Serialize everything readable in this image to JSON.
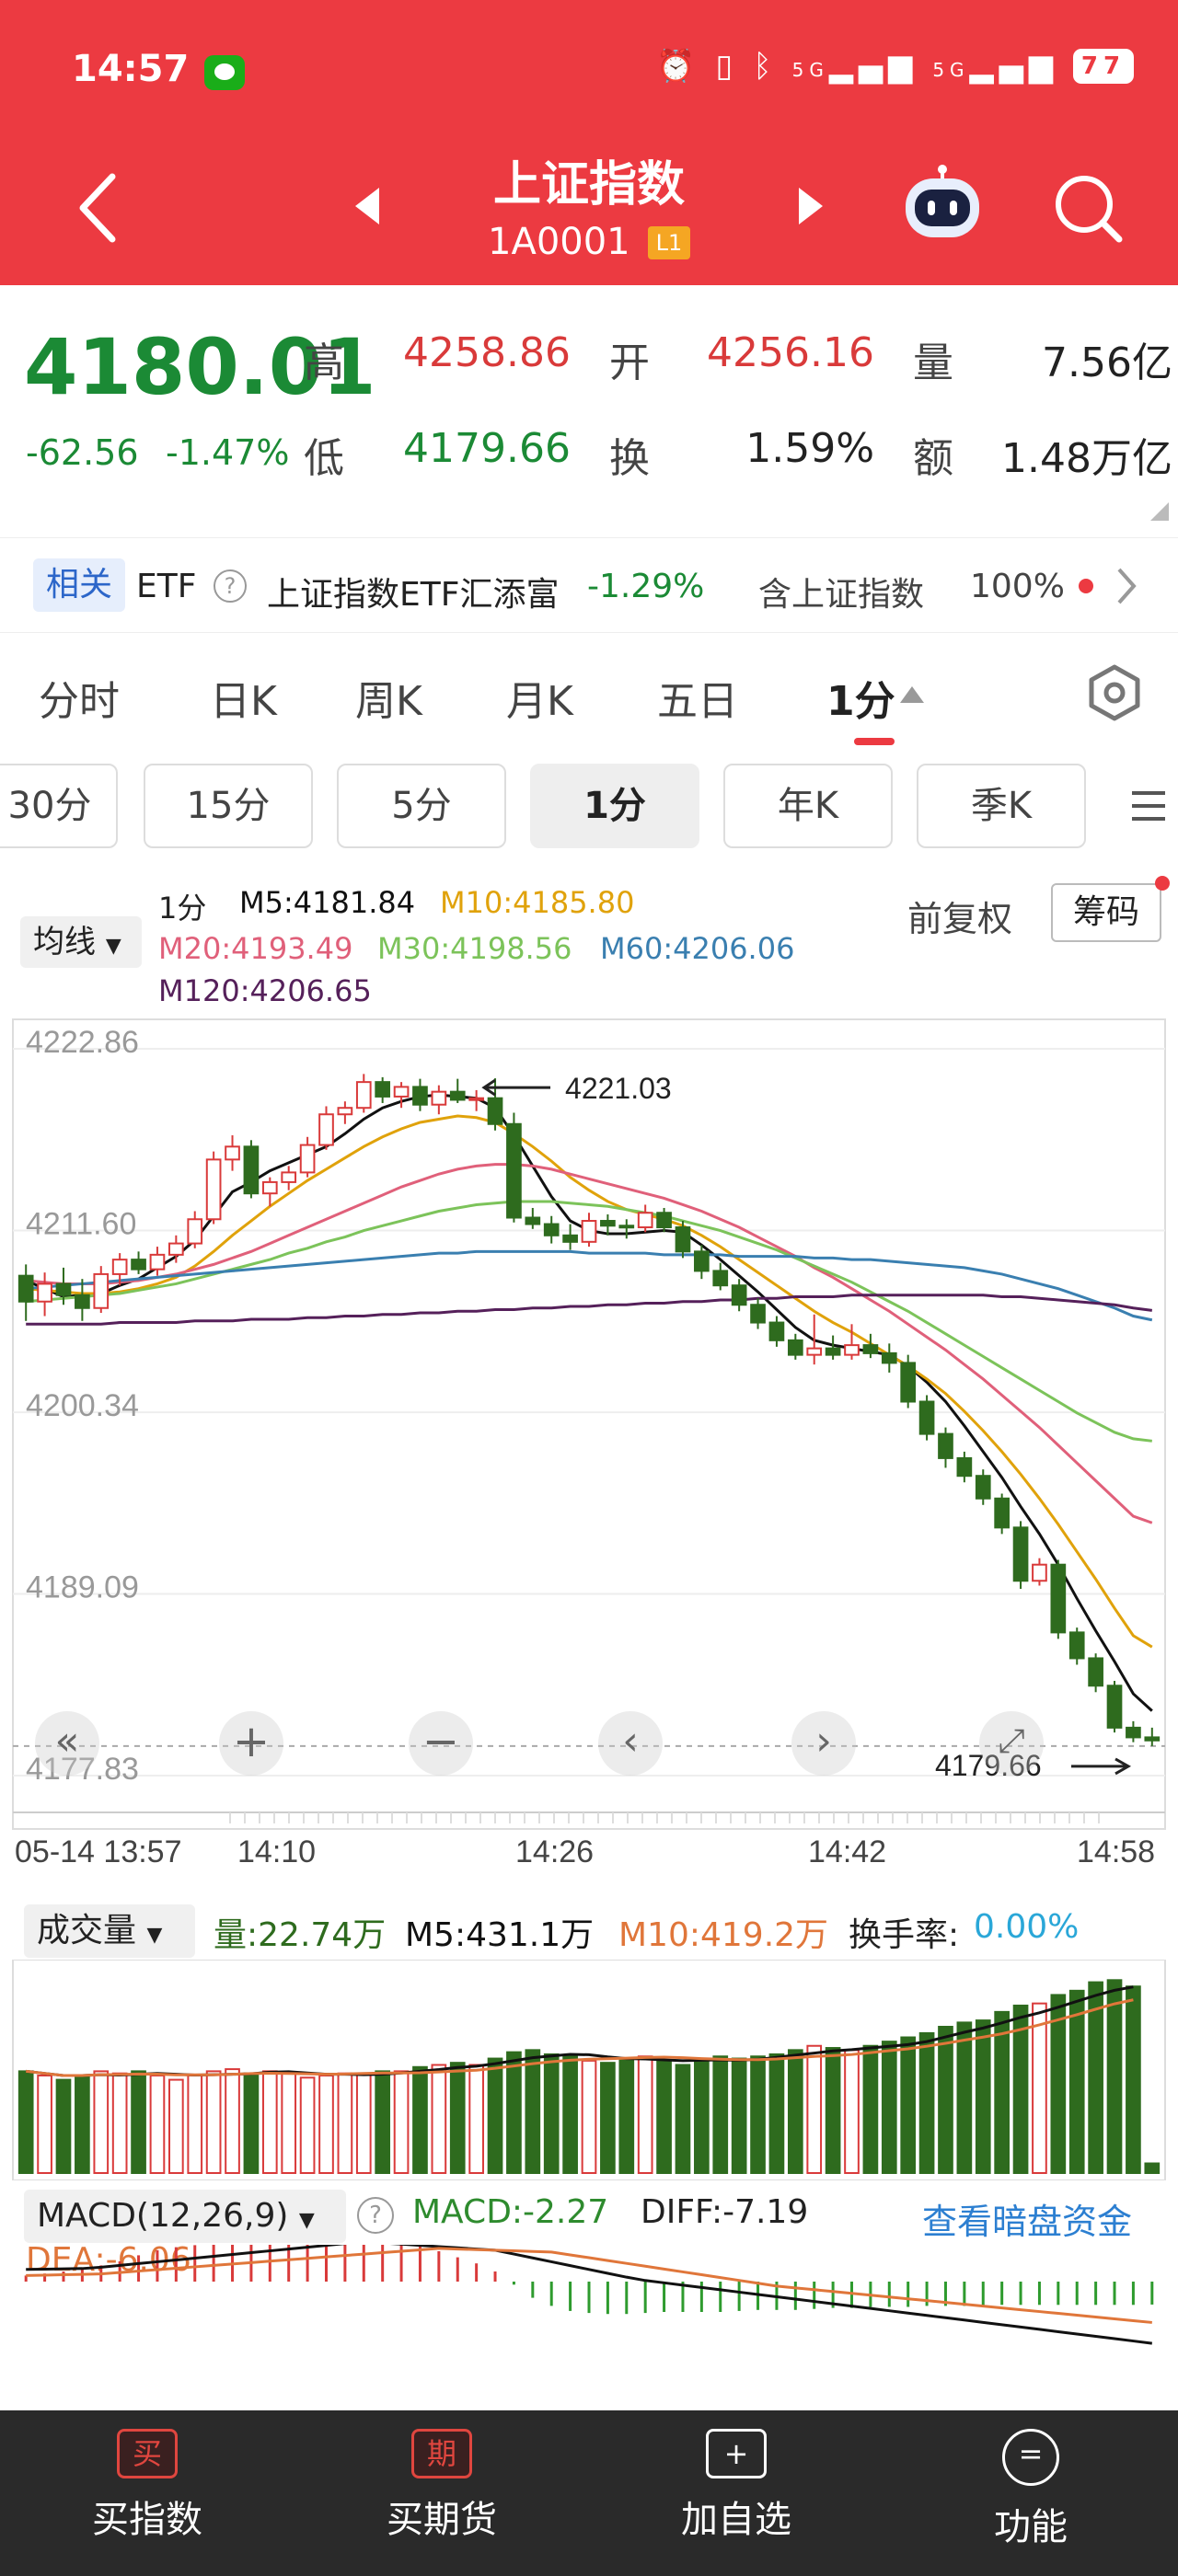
{
  "status": {
    "time": "14:57",
    "signal_5g_1": "5G",
    "signal_5g_2": "5G",
    "battery": "77"
  },
  "nav": {
    "title": "上证指数",
    "code": "1A0001",
    "level": "L1"
  },
  "quote": {
    "price": "4180.01",
    "change": "-62.56",
    "change_pct": "-1.47%",
    "high_label": "高",
    "high": "4258.86",
    "open_label": "开",
    "open": "4256.16",
    "volume_label": "量",
    "volume": "7.56亿",
    "low_label": "低",
    "low": "4179.66",
    "turnover_label": "换",
    "turnover": "1.59%",
    "amount_label": "额",
    "amount": "1.48万亿"
  },
  "etf": {
    "tag": "相关",
    "etf_label": "ETF",
    "name": "上证指数ETF汇添富",
    "change": "-1.29%",
    "contains": "含上证指数",
    "weight": "100%"
  },
  "tabs": [
    "分时",
    "日K",
    "周K",
    "月K",
    "五日",
    "1分"
  ],
  "period_buttons": [
    "30分",
    "15分",
    "5分",
    "1分",
    "年K",
    "季K"
  ],
  "ma": {
    "selector": "均线",
    "period": "1分",
    "m5": "M5:4181.84",
    "m10": "M10:4185.80",
    "m20": "M20:4193.49",
    "m30": "M30:4198.56",
    "m60": "M60:4206.06",
    "m120": "M120:4206.65",
    "adjust": "前复权",
    "chips": "筹码"
  },
  "colors": {
    "up": "#d93a3a",
    "down": "#2e6b1e",
    "m5": "#111111",
    "m10": "#e0a20b",
    "m20": "#e0607a",
    "m30": "#7cc35a",
    "m60": "#3a7fb0",
    "m120": "#55205a",
    "brand": "#ec3a41"
  },
  "main_chart": {
    "y_ticks": [
      "4222.86",
      "4211.60",
      "4200.34",
      "4189.09",
      "4177.83"
    ],
    "x_ticks": [
      "05-14 13:57",
      "14:10",
      "14:26",
      "14:42",
      "14:58"
    ],
    "high_mark": "4221.03",
    "low_mark": "4179.66"
  },
  "volume": {
    "selector": "成交量",
    "vol": "量:22.74万",
    "m5": "M5:431.1万",
    "m10": "M10:419.2万",
    "turnover_label": "换手率:",
    "turnover": "0.00%"
  },
  "macd": {
    "selector": "MACD(12,26,9)",
    "macd": "MACD:-2.27",
    "diff": "DIFF:-7.19",
    "dea": "DEA:-6.06",
    "link": "查看暗盘资金"
  },
  "bottom_nav": [
    {
      "icon": "买",
      "label": "买指数"
    },
    {
      "icon": "期",
      "label": "买期货"
    },
    {
      "icon": "+",
      "label": "加自选"
    },
    {
      "icon": "=",
      "label": "功能"
    }
  ],
  "chart_data": {
    "type": "candlestick",
    "y_range": [
      4177.83,
      4222.86
    ],
    "candles": [
      [
        4208.8,
        4209.5,
        4206.0,
        4207.2
      ],
      [
        4207.2,
        4209.0,
        4206.3,
        4208.3
      ],
      [
        4208.3,
        4209.3,
        4207.0,
        4207.6
      ],
      [
        4207.6,
        4208.6,
        4206.0,
        4206.8
      ],
      [
        4206.8,
        4209.4,
        4206.5,
        4208.9
      ],
      [
        4208.9,
        4210.2,
        4208.2,
        4209.8
      ],
      [
        4209.8,
        4210.3,
        4208.9,
        4209.2
      ],
      [
        4209.2,
        4210.6,
        4208.8,
        4210.1
      ],
      [
        4210.1,
        4211.3,
        4209.6,
        4210.8
      ],
      [
        4210.8,
        4212.8,
        4210.5,
        4212.3
      ],
      [
        4212.3,
        4216.5,
        4212.0,
        4216.0
      ],
      [
        4216.0,
        4217.5,
        4215.3,
        4216.8
      ],
      [
        4216.8,
        4217.2,
        4213.6,
        4213.9
      ],
      [
        4213.9,
        4214.9,
        4213.1,
        4214.6
      ],
      [
        4214.6,
        4215.6,
        4214.1,
        4215.2
      ],
      [
        4215.2,
        4217.4,
        4214.9,
        4216.9
      ],
      [
        4216.9,
        4219.3,
        4216.6,
        4218.8
      ],
      [
        4218.8,
        4219.6,
        4218.2,
        4219.2
      ],
      [
        4219.2,
        4221.3,
        4218.9,
        4220.8
      ],
      [
        4220.8,
        4221.1,
        4219.5,
        4219.9
      ],
      [
        4219.9,
        4220.8,
        4219.2,
        4220.5
      ],
      [
        4220.5,
        4221.0,
        4219.0,
        4219.4
      ],
      [
        4219.4,
        4220.6,
        4218.8,
        4220.2
      ],
      [
        4220.2,
        4221.0,
        4219.5,
        4219.7
      ],
      [
        4219.7,
        4220.3,
        4219.0,
        4219.8
      ],
      [
        4219.8,
        4221.03,
        4217.8,
        4218.2
      ],
      [
        4218.2,
        4218.9,
        4212.1,
        4212.4
      ],
      [
        4212.4,
        4213.0,
        4211.7,
        4212.0
      ],
      [
        4212.0,
        4212.5,
        4210.8,
        4211.3
      ],
      [
        4211.3,
        4212.0,
        4210.4,
        4210.9
      ],
      [
        4210.9,
        4212.7,
        4210.6,
        4212.2
      ],
      [
        4212.2,
        4212.6,
        4211.3,
        4211.9
      ],
      [
        4211.9,
        4212.3,
        4211.1,
        4211.8
      ],
      [
        4211.8,
        4213.2,
        4211.5,
        4212.7
      ],
      [
        4212.7,
        4213.0,
        4211.5,
        4211.8
      ],
      [
        4211.8,
        4212.2,
        4209.9,
        4210.3
      ],
      [
        4210.3,
        4210.7,
        4208.6,
        4209.1
      ],
      [
        4209.1,
        4209.6,
        4207.9,
        4208.2
      ],
      [
        4208.2,
        4208.6,
        4206.6,
        4207.0
      ],
      [
        4207.0,
        4207.4,
        4205.5,
        4205.9
      ],
      [
        4205.9,
        4206.3,
        4204.4,
        4204.8
      ],
      [
        4204.8,
        4205.2,
        4203.6,
        4203.9
      ],
      [
        4203.9,
        4206.4,
        4203.3,
        4204.3
      ],
      [
        4204.3,
        4205.1,
        4203.6,
        4203.9
      ],
      [
        4203.9,
        4205.8,
        4203.6,
        4204.5
      ],
      [
        4204.5,
        4205.2,
        4203.7,
        4204.0
      ],
      [
        4204.0,
        4204.6,
        4202.8,
        4203.4
      ],
      [
        4203.4,
        4203.9,
        4200.6,
        4201.0
      ],
      [
        4201.0,
        4201.4,
        4198.6,
        4199.0
      ],
      [
        4199.0,
        4199.4,
        4196.9,
        4197.5
      ],
      [
        4197.5,
        4197.9,
        4196.0,
        4196.4
      ],
      [
        4196.4,
        4196.8,
        4194.6,
        4195.0
      ],
      [
        4195.0,
        4195.3,
        4192.8,
        4193.2
      ],
      [
        4193.2,
        4193.6,
        4189.4,
        4189.9
      ],
      [
        4189.9,
        4191.3,
        4189.6,
        4190.9
      ],
      [
        4190.9,
        4191.2,
        4186.3,
        4186.7
      ],
      [
        4186.7,
        4187.0,
        4184.7,
        4185.1
      ],
      [
        4185.1,
        4185.4,
        4183.0,
        4183.4
      ],
      [
        4183.4,
        4183.7,
        4180.5,
        4180.8
      ],
      [
        4180.8,
        4181.2,
        4179.9,
        4180.2
      ],
      [
        4180.2,
        4180.8,
        4179.66,
        4180.01
      ]
    ],
    "ma_series": {
      "M5": [
        4208.5,
        4208.0,
        4207.5,
        4207.6,
        4207.7,
        4208.2,
        4208.6,
        4209.3,
        4210.0,
        4211.0,
        4212.5,
        4214.0,
        4214.6,
        4215.3,
        4215.8,
        4216.3,
        4216.8,
        4217.6,
        4218.5,
        4219.2,
        4219.6,
        4219.9,
        4220.0,
        4219.9,
        4219.8,
        4219.2,
        4217.5,
        4215.6,
        4213.7,
        4212.2,
        4211.6,
        4211.4,
        4211.4,
        4211.5,
        4211.6,
        4211.5,
        4210.7,
        4209.8,
        4208.8,
        4207.8,
        4206.7,
        4205.6,
        4204.8,
        4204.5,
        4204.3,
        4204.1,
        4203.9,
        4203.2,
        4202.2,
        4201.0,
        4199.5,
        4197.9,
        4196.3,
        4194.5,
        4192.8,
        4190.9,
        4188.8,
        4186.8,
        4184.9,
        4182.9,
        4181.84
      ],
      "M10": [
        4208.0,
        4207.9,
        4207.8,
        4207.7,
        4207.7,
        4207.8,
        4208.0,
        4208.3,
        4208.7,
        4209.4,
        4210.3,
        4211.3,
        4212.2,
        4213.1,
        4213.9,
        4214.7,
        4215.4,
        4216.1,
        4216.8,
        4217.4,
        4217.9,
        4218.3,
        4218.5,
        4218.7,
        4218.6,
        4218.3,
        4217.6,
        4216.8,
        4215.9,
        4214.9,
        4214.1,
        4213.4,
        4212.9,
        4212.6,
        4212.3,
        4211.9,
        4211.3,
        4210.6,
        4209.8,
        4209.0,
        4208.2,
        4207.4,
        4206.6,
        4205.9,
        4205.3,
        4204.6,
        4203.9,
        4203.2,
        4202.4,
        4201.5,
        4200.4,
        4199.2,
        4197.9,
        4196.5,
        4195.0,
        4193.4,
        4191.7,
        4190.0,
        4188.2,
        4186.5,
        4185.8
      ],
      "M20": [
        4208.5,
        4208.4,
        4208.3,
        4208.3,
        4208.3,
        4208.4,
        4208.5,
        4208.7,
        4208.9,
        4209.2,
        4209.5,
        4209.9,
        4210.3,
        4210.8,
        4211.3,
        4211.8,
        4212.3,
        4212.8,
        4213.3,
        4213.8,
        4214.3,
        4214.7,
        4215.1,
        4215.4,
        4215.6,
        4215.7,
        4215.7,
        4215.6,
        4215.4,
        4215.1,
        4214.8,
        4214.5,
        4214.2,
        4213.9,
        4213.6,
        4213.2,
        4212.8,
        4212.3,
        4211.8,
        4211.2,
        4210.6,
        4210.0,
        4209.3,
        4208.7,
        4208.0,
        4207.3,
        4206.6,
        4205.8,
        4205.0,
        4204.2,
        4203.3,
        4202.4,
        4201.4,
        4200.4,
        4199.4,
        4198.3,
        4197.2,
        4196.1,
        4195.0,
        4193.9,
        4193.49
      ],
      "M30": [
        4207.2,
        4207.3,
        4207.4,
        4207.5,
        4207.6,
        4207.7,
        4207.9,
        4208.1,
        4208.3,
        4208.6,
        4208.9,
        4209.2,
        4209.5,
        4209.8,
        4210.2,
        4210.5,
        4210.9,
        4211.2,
        4211.6,
        4211.9,
        4212.2,
        4212.5,
        4212.8,
        4213.0,
        4213.2,
        4213.3,
        4213.4,
        4213.4,
        4213.4,
        4213.3,
        4213.2,
        4213.1,
        4212.9,
        4212.7,
        4212.5,
        4212.2,
        4211.9,
        4211.6,
        4211.2,
        4210.8,
        4210.4,
        4209.9,
        4209.4,
        4208.9,
        4208.4,
        4207.8,
        4207.2,
        4206.6,
        4205.9,
        4205.2,
        4204.5,
        4203.8,
        4203.1,
        4202.4,
        4201.7,
        4201.0,
        4200.3,
        4199.7,
        4199.1,
        4198.7,
        4198.56
      ],
      "M60": [
        4208.0,
        4208.1,
        4208.2,
        4208.3,
        4208.4,
        4208.5,
        4208.6,
        4208.7,
        4208.8,
        4208.9,
        4209.0,
        4209.1,
        4209.2,
        4209.3,
        4209.4,
        4209.5,
        4209.6,
        4209.7,
        4209.8,
        4209.9,
        4210.0,
        4210.1,
        4210.2,
        4210.2,
        4210.3,
        4210.3,
        4210.3,
        4210.3,
        4210.3,
        4210.3,
        4210.2,
        4210.2,
        4210.2,
        4210.2,
        4210.1,
        4210.1,
        4210.1,
        4210.1,
        4210.0,
        4210.0,
        4210.0,
        4210.0,
        4209.9,
        4209.9,
        4209.8,
        4209.8,
        4209.7,
        4209.6,
        4209.5,
        4209.4,
        4209.3,
        4209.1,
        4208.9,
        4208.6,
        4208.3,
        4208.0,
        4207.6,
        4207.2,
        4206.8,
        4206.3,
        4206.06
      ],
      "M120": [
        4205.8,
        4205.8,
        4205.8,
        4205.8,
        4205.8,
        4205.9,
        4205.9,
        4205.9,
        4205.9,
        4206.0,
        4206.0,
        4206.0,
        4206.1,
        4206.1,
        4206.1,
        4206.2,
        4206.2,
        4206.3,
        4206.3,
        4206.4,
        4206.4,
        4206.5,
        4206.5,
        4206.6,
        4206.6,
        4206.7,
        4206.7,
        4206.8,
        4206.8,
        4206.9,
        4206.9,
        4207.0,
        4207.0,
        4207.1,
        4207.1,
        4207.2,
        4207.2,
        4207.3,
        4207.3,
        4207.4,
        4207.4,
        4207.5,
        4207.5,
        4207.5,
        4207.6,
        4207.6,
        4207.6,
        4207.6,
        4207.6,
        4207.6,
        4207.6,
        4207.6,
        4207.5,
        4207.5,
        4207.4,
        4207.3,
        4207.2,
        4207.1,
        4207.0,
        4206.8,
        4206.65
      ]
    },
    "volume_bars": [
      240,
      230,
      220,
      230,
      240,
      235,
      240,
      230,
      220,
      230,
      240,
      245,
      235,
      240,
      235,
      225,
      230,
      235,
      235,
      240,
      240,
      250,
      255,
      260,
      255,
      270,
      285,
      290,
      280,
      275,
      265,
      260,
      270,
      275,
      265,
      255,
      265,
      275,
      270,
      275,
      280,
      290,
      300,
      295,
      290,
      300,
      310,
      320,
      330,
      345,
      355,
      360,
      380,
      395,
      400,
      420,
      430,
      450,
      455,
      440,
      22.74
    ],
    "macd_hist": [
      0.6,
      0.8,
      1.0,
      1.2,
      1.6,
      2.0,
      2.6,
      3.1,
      3.4,
      3.6,
      3.9,
      4.2,
      4.4,
      4.6,
      4.8,
      5.0,
      5.1,
      5.0,
      4.7,
      4.3,
      3.9,
      3.5,
      3.0,
      2.4,
      1.8,
      1.0,
      -0.3,
      -1.6,
      -2.4,
      -2.9,
      -3.1,
      -3.2,
      -3.2,
      -3.1,
      -3.0,
      -3.0,
      -3.0,
      -3.0,
      -2.9,
      -2.8,
      -2.8,
      -2.8,
      -2.7,
      -2.6,
      -2.6,
      -2.5,
      -2.5,
      -2.5,
      -2.4,
      -2.4,
      -2.4,
      -2.4,
      -2.3,
      -2.3,
      -2.3,
      -2.3,
      -2.3,
      -2.3,
      -2.3,
      -2.3,
      -2.27
    ]
  }
}
